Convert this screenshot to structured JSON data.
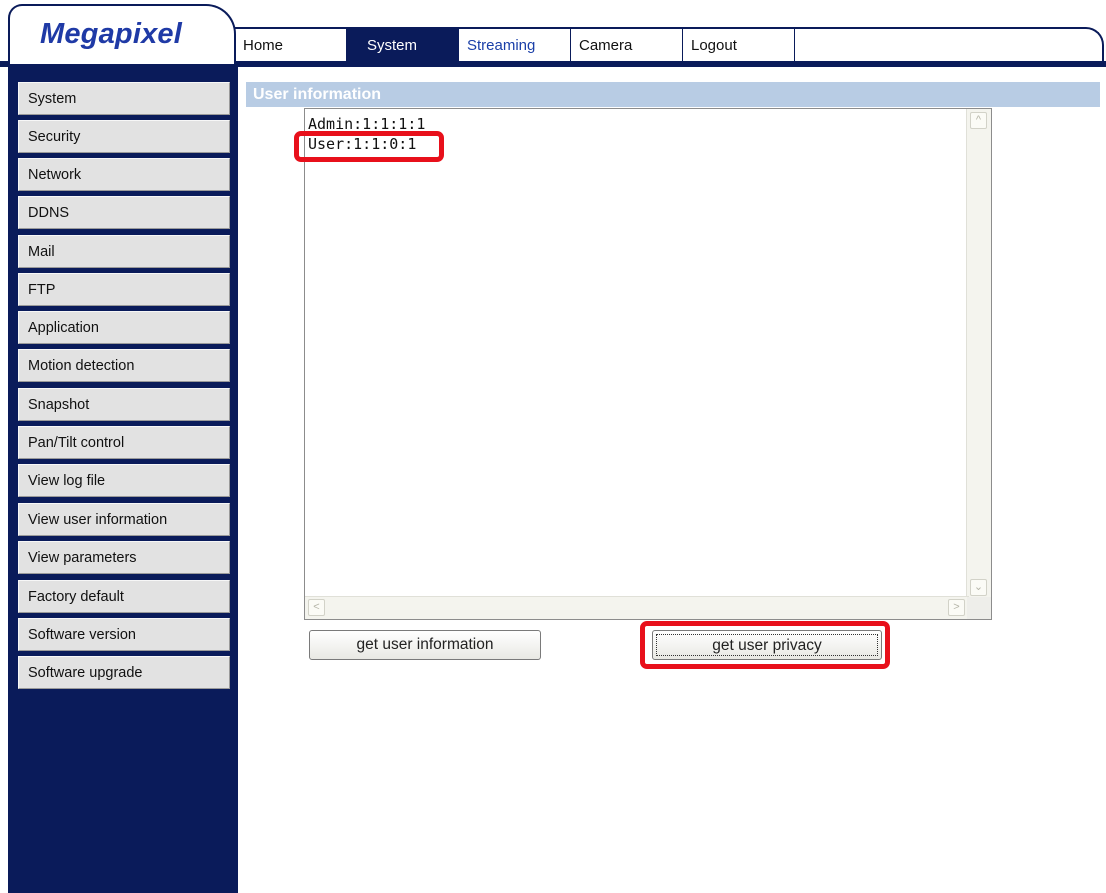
{
  "brand": {
    "logo_text": "Megapixel"
  },
  "topnav": {
    "tabs": [
      {
        "label": "Home"
      },
      {
        "label": "System"
      },
      {
        "label": "Streaming"
      },
      {
        "label": "Camera"
      },
      {
        "label": "Logout"
      }
    ],
    "active_tab": "System"
  },
  "sidebar": {
    "items": [
      {
        "label": "System"
      },
      {
        "label": "Security"
      },
      {
        "label": "Network"
      },
      {
        "label": "DDNS"
      },
      {
        "label": "Mail"
      },
      {
        "label": "FTP"
      },
      {
        "label": "Application"
      },
      {
        "label": "Motion detection"
      },
      {
        "label": "Snapshot"
      },
      {
        "label": "Pan/Tilt control"
      },
      {
        "label": "View log file"
      },
      {
        "label": "View user information"
      },
      {
        "label": "View parameters"
      },
      {
        "label": "Factory default"
      },
      {
        "label": "Software version"
      },
      {
        "label": "Software upgrade"
      }
    ]
  },
  "main": {
    "section_title": "User information",
    "user_list": [
      "Admin:1:1:1:1",
      "User:1:1:0:1"
    ],
    "buttons": {
      "get_user_information": "get user information",
      "get_user_privacy": "get user privacy"
    }
  },
  "colors": {
    "navy": "#0a1b5a",
    "section_header": "#b8cce4",
    "highlight_red": "#e8101b",
    "logo_blue": "#1f3aa6"
  },
  "icons": {
    "scroll_up": "chevron-up-icon",
    "scroll_down": "chevron-down-icon",
    "scroll_left": "chevron-left-icon",
    "scroll_right": "chevron-right-icon"
  }
}
